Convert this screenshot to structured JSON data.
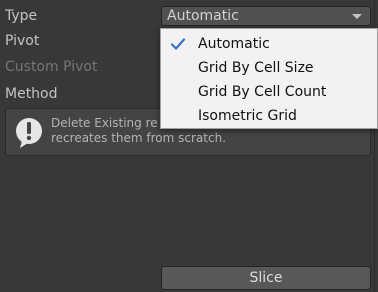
{
  "fields": {
    "type_label": "Type",
    "pivot_label": "Pivot",
    "custom_pivot_label": "Custom Pivot",
    "method_label": "Method"
  },
  "type_dropdown": {
    "value": "Automatic",
    "options": [
      {
        "label": "Automatic",
        "selected": true
      },
      {
        "label": "Grid By Cell Size",
        "selected": false
      },
      {
        "label": "Grid By Cell Count",
        "selected": false
      },
      {
        "label": "Isometric Grid",
        "selected": false
      }
    ]
  },
  "helpbox": {
    "icon": "exclamation-circle-icon",
    "line1": "Delete Existing re",
    "line2": "recreates them from scratch."
  },
  "actions": {
    "slice_label": "Slice"
  },
  "colors": {
    "background": "#383838",
    "popup_background": "#f2f2f2",
    "check_accent": "#3b6fbd"
  }
}
